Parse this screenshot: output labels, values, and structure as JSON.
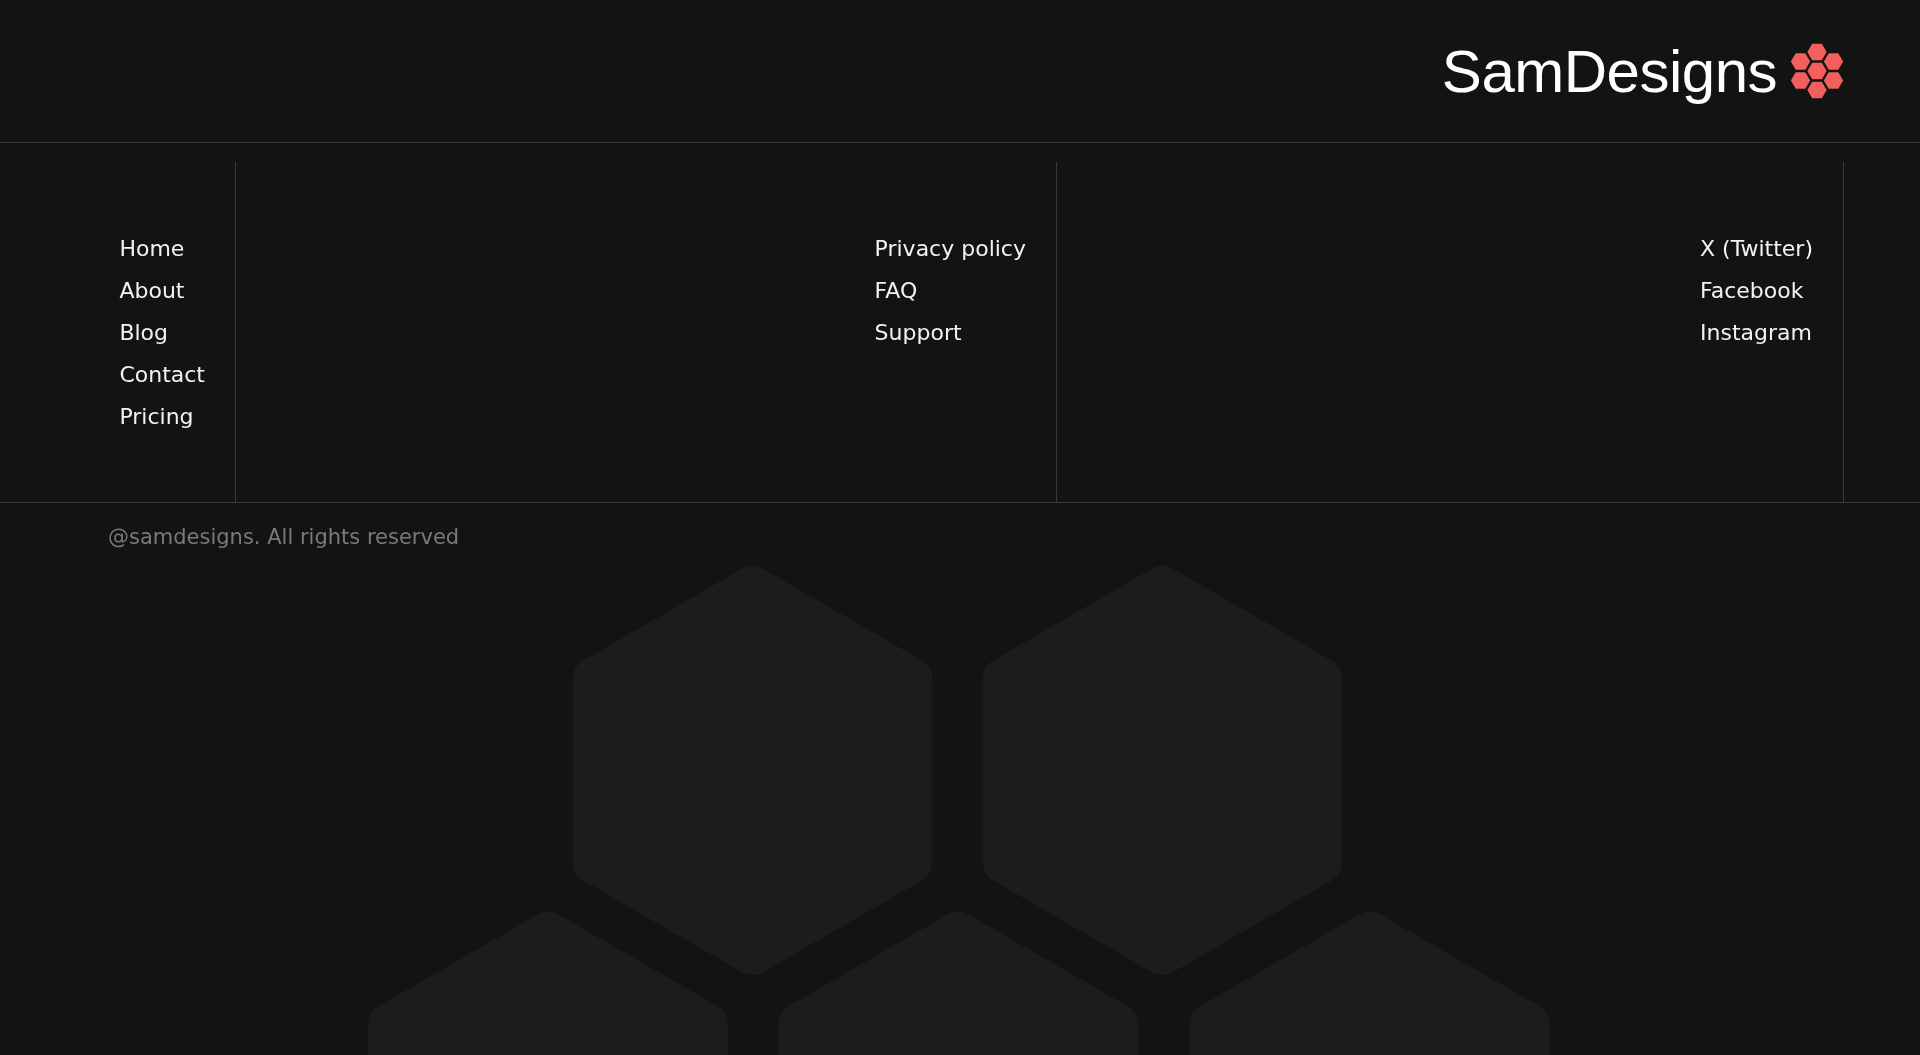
{
  "header": {
    "logo_text": "SamDesigns"
  },
  "columns": [
    {
      "links": [
        "Home",
        "About",
        "Blog",
        "Contact",
        "Pricing"
      ]
    },
    {
      "links": [
        "Privacy policy",
        "FAQ",
        "Support"
      ]
    },
    {
      "links": [
        "X (Twitter)",
        "Facebook",
        "Instagram"
      ]
    }
  ],
  "copyright": "@samdesigns. All rights reserved"
}
